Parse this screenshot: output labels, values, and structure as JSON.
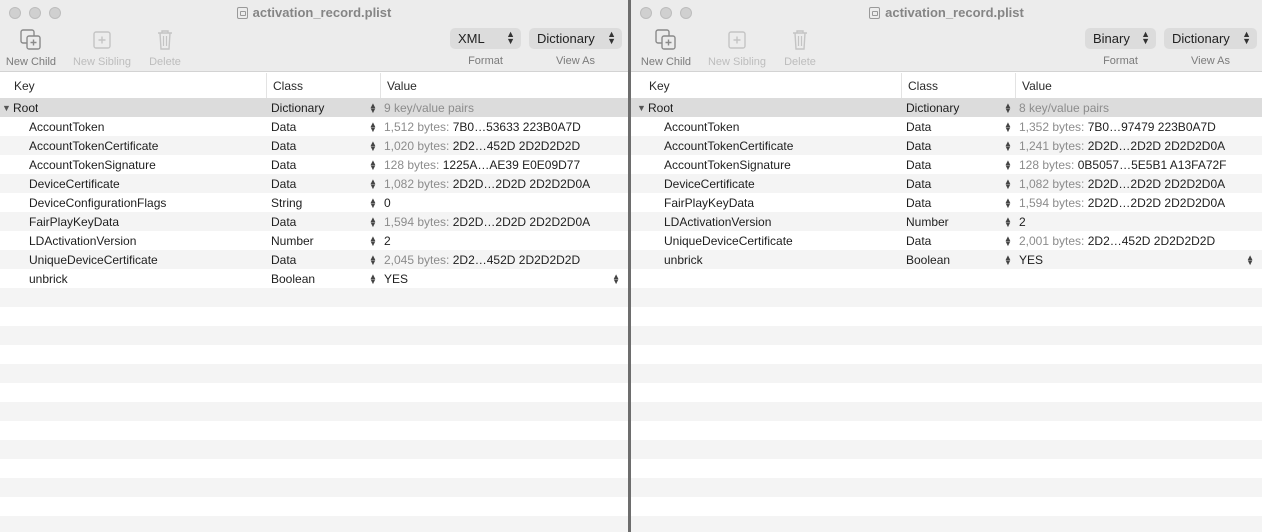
{
  "left": {
    "title": "activation_record.plist",
    "toolbar": {
      "new_child": "New Child",
      "new_sibling": "New Sibling",
      "delete": "Delete",
      "format_value": "XML",
      "format_label": "Format",
      "viewas_value": "Dictionary",
      "viewas_label": "View As"
    },
    "columns": {
      "key": "Key",
      "class": "Class",
      "value": "Value"
    },
    "root": {
      "key": "Root",
      "class": "Dictionary",
      "value": "9 key/value pairs"
    },
    "rows": [
      {
        "key": "AccountToken",
        "class": "Data",
        "prefix": "1,512 bytes:",
        "value": "7B0…53633 223B0A7D"
      },
      {
        "key": "AccountTokenCertificate",
        "class": "Data",
        "prefix": "1,020 bytes:",
        "value": "2D2…452D 2D2D2D2D"
      },
      {
        "key": "AccountTokenSignature",
        "class": "Data",
        "prefix": "128 bytes:",
        "value": "1225A…AE39 E0E09D77"
      },
      {
        "key": "DeviceCertificate",
        "class": "Data",
        "prefix": "1,082 bytes:",
        "value": "2D2D…2D2D 2D2D2D0A"
      },
      {
        "key": "DeviceConfigurationFlags",
        "class": "String",
        "prefix": "",
        "value": "0"
      },
      {
        "key": "FairPlayKeyData",
        "class": "Data",
        "prefix": "1,594 bytes:",
        "value": "2D2D…2D2D 2D2D2D0A"
      },
      {
        "key": "LDActivationVersion",
        "class": "Number",
        "prefix": "",
        "value": "2"
      },
      {
        "key": "UniqueDeviceCertificate",
        "class": "Data",
        "prefix": "2,045 bytes:",
        "value": "2D2…452D 2D2D2D2D"
      },
      {
        "key": "unbrick",
        "class": "Boolean",
        "prefix": "",
        "value": "YES"
      }
    ]
  },
  "right": {
    "title": "activation_record.plist",
    "toolbar": {
      "new_child": "New Child",
      "new_sibling": "New Sibling",
      "delete": "Delete",
      "format_value": "Binary",
      "format_label": "Format",
      "viewas_value": "Dictionary",
      "viewas_label": "View As"
    },
    "columns": {
      "key": "Key",
      "class": "Class",
      "value": "Value"
    },
    "root": {
      "key": "Root",
      "class": "Dictionary",
      "value": "8 key/value pairs"
    },
    "rows": [
      {
        "key": "AccountToken",
        "class": "Data",
        "prefix": "1,352 bytes:",
        "value": "7B0…97479 223B0A7D"
      },
      {
        "key": "AccountTokenCertificate",
        "class": "Data",
        "prefix": "1,241 bytes:",
        "value": "2D2D…2D2D 2D2D2D0A"
      },
      {
        "key": "AccountTokenSignature",
        "class": "Data",
        "prefix": "128 bytes:",
        "value": "0B5057…5E5B1 A13FA72F"
      },
      {
        "key": "DeviceCertificate",
        "class": "Data",
        "prefix": "1,082 bytes:",
        "value": "2D2D…2D2D 2D2D2D0A"
      },
      {
        "key": "FairPlayKeyData",
        "class": "Data",
        "prefix": "1,594 bytes:",
        "value": "2D2D…2D2D 2D2D2D0A"
      },
      {
        "key": "LDActivationVersion",
        "class": "Number",
        "prefix": "",
        "value": "2"
      },
      {
        "key": "UniqueDeviceCertificate",
        "class": "Data",
        "prefix": "2,001 bytes:",
        "value": "2D2…452D 2D2D2D2D"
      },
      {
        "key": "unbrick",
        "class": "Boolean",
        "prefix": "",
        "value": "YES"
      }
    ]
  }
}
